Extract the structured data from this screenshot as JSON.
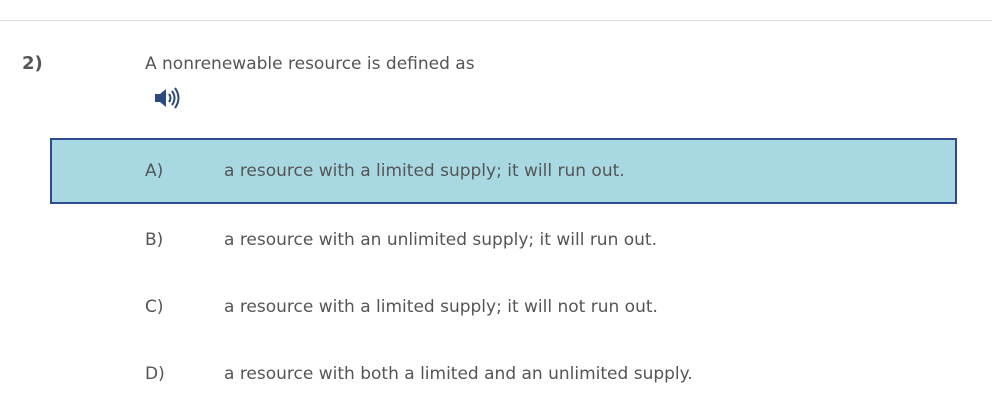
{
  "question": {
    "number": "2)",
    "text": "A nonrenewable resource is defined as",
    "audio_icon": "speaker-icon"
  },
  "options": [
    {
      "letter": "A)",
      "text": "a resource with a limited supply; it will run out.",
      "selected": true
    },
    {
      "letter": "B)",
      "text": "a resource with an unlimited supply; it will run out.",
      "selected": false
    },
    {
      "letter": "C)",
      "text": "a resource with a limited supply; it will not run out.",
      "selected": false
    },
    {
      "letter": "D)",
      "text": "a resource with both a limited and an unlimited supply.",
      "selected": false
    }
  ],
  "colors": {
    "selected_background": "#a8d8e2",
    "selected_border": "#2f4b8f",
    "speaker_icon": "#2a4b7c"
  }
}
